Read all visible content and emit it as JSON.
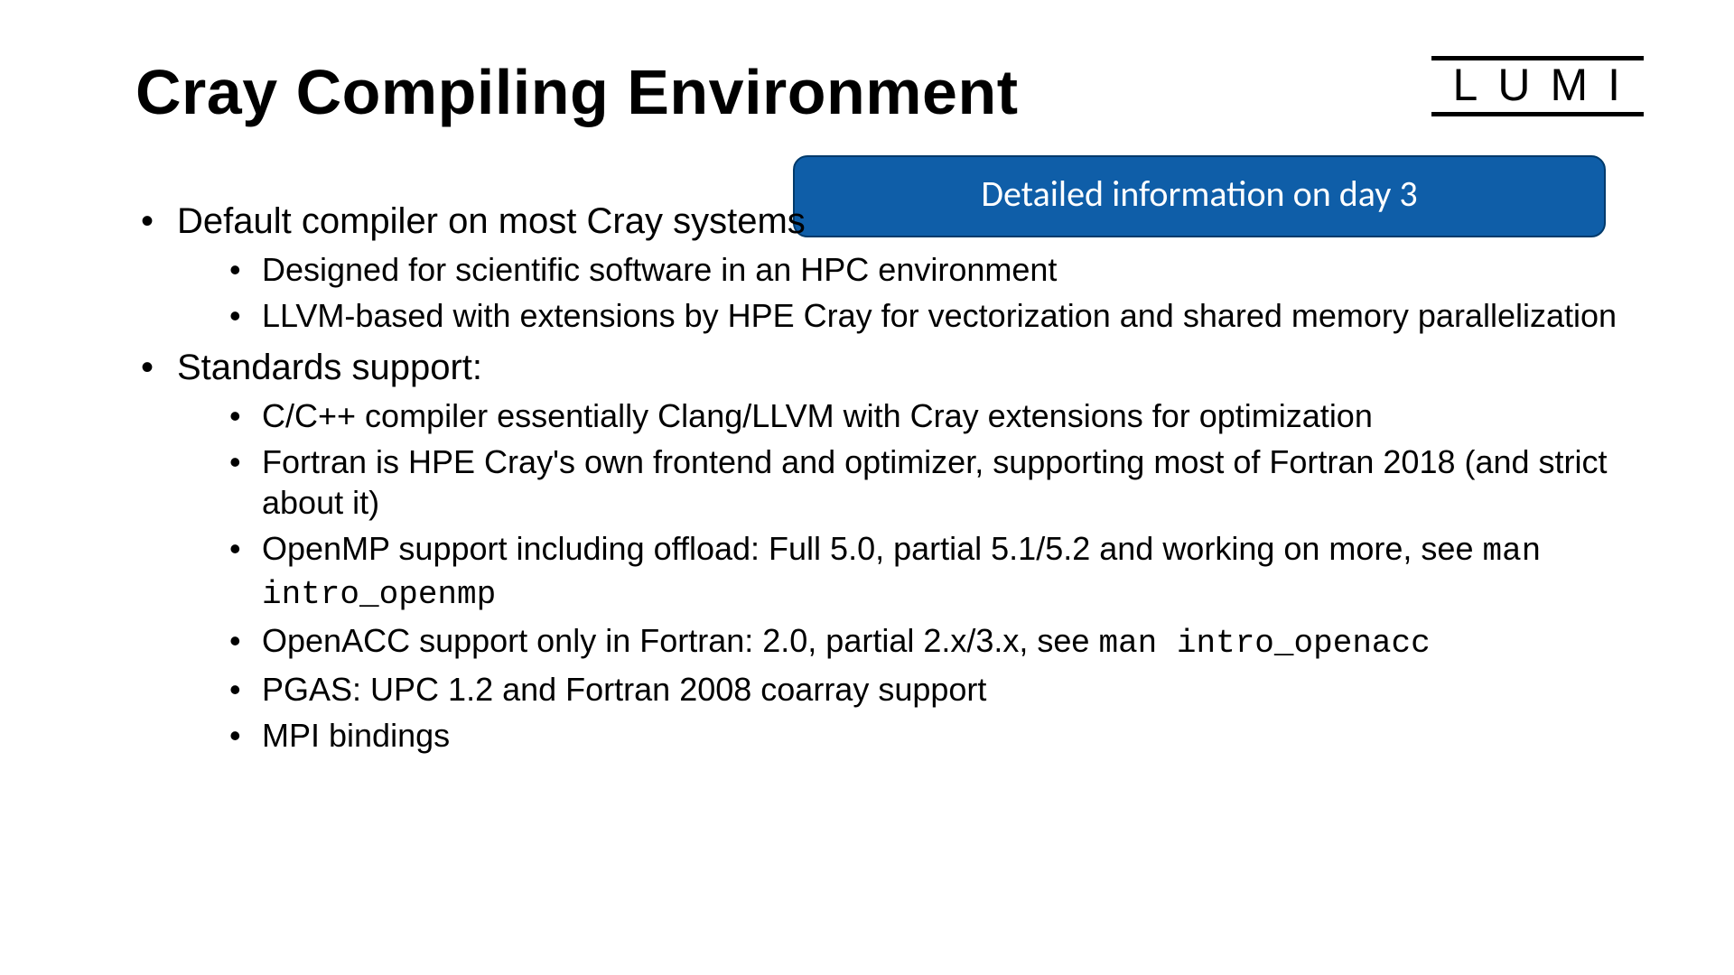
{
  "title": "Cray Compiling Environment",
  "logo": "LUMI",
  "callout": "Detailed information on day 3",
  "bullets": {
    "b1": "Default compiler on most Cray systems",
    "b1s1": "Designed for scientific software in an HPC environment",
    "b1s2": "LLVM-based with extensions by HPE Cray for vectorization and shared memory parallelization",
    "b2": "Standards support:",
    "b2s1": "C/C++ compiler essentially Clang/LLVM with Cray extensions for optimization",
    "b2s2": "Fortran is HPE Cray's own frontend and optimizer, supporting most of Fortran 2018 (and strict about it)",
    "b2s3_a": "OpenMP support including offload: Full 5.0, partial 5.1/5.2 and working on more, see ",
    "b2s3_code": "man intro_openmp",
    "b2s4_a": "OpenACC support only in Fortran: 2.0, partial 2.x/3.x, see ",
    "b2s4_code": "man intro_openacc",
    "b2s5": "PGAS: UPC 1.2 and Fortran 2008 coarray support",
    "b2s6": "MPI bindings"
  }
}
